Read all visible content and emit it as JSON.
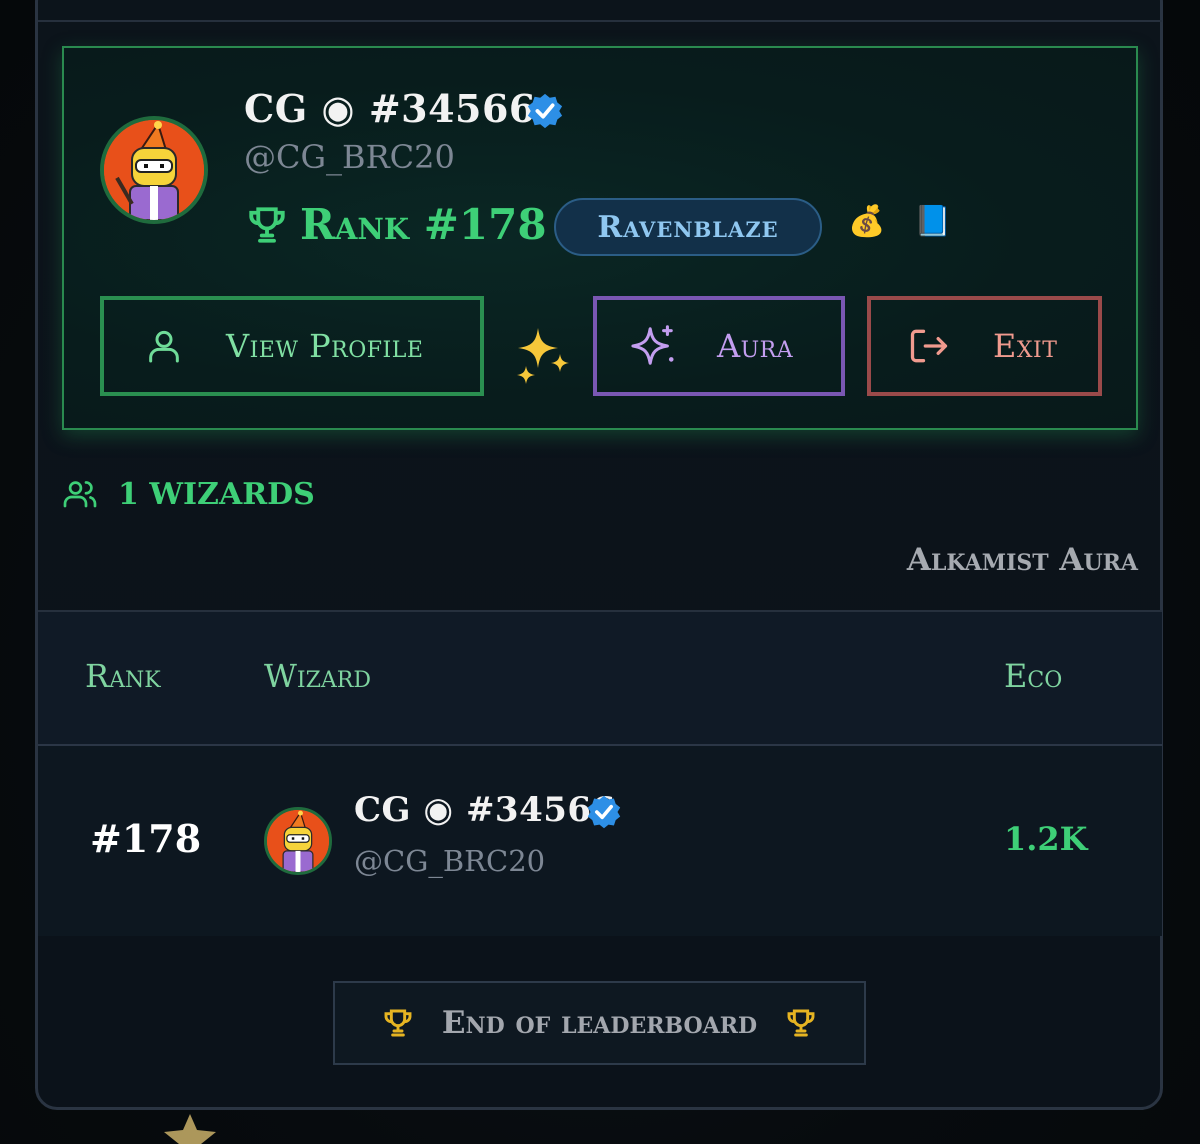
{
  "profile": {
    "name": "CG ◉ #34566",
    "handle": "@CG_BRC20",
    "verified": true,
    "rank_label": "Rank #178",
    "guild": "Ravenblaze",
    "badges": [
      "💰",
      "📘"
    ],
    "buttons": {
      "view_profile": "View Profile",
      "aura": "Aura",
      "exit": "Exit"
    }
  },
  "leaderboard": {
    "wizard_count": "1 WIZARDS",
    "aura_label": "Alkamist Aura",
    "columns": [
      "Rank",
      "Wizard",
      "Eco"
    ],
    "rows": [
      {
        "rank": "#178",
        "name": "CG ◉ #34566",
        "handle": "@CG_BRC20",
        "eco": "1.2K"
      }
    ],
    "end_label": "End of leaderboard"
  },
  "colors": {
    "accent_green": "#3ecf77",
    "aura_purple": "#7a57b3",
    "exit_red": "#9a4a4a",
    "guild_blue": "#123049",
    "verified_blue": "#2d8fe6",
    "trophy_gold": "#e6b422"
  },
  "icons": {
    "verified": "verified-badge-icon",
    "trophy": "trophy-icon",
    "user": "user-icon",
    "sparkle": "sparkle-icon",
    "exit": "logout-icon",
    "users": "users-icon"
  }
}
